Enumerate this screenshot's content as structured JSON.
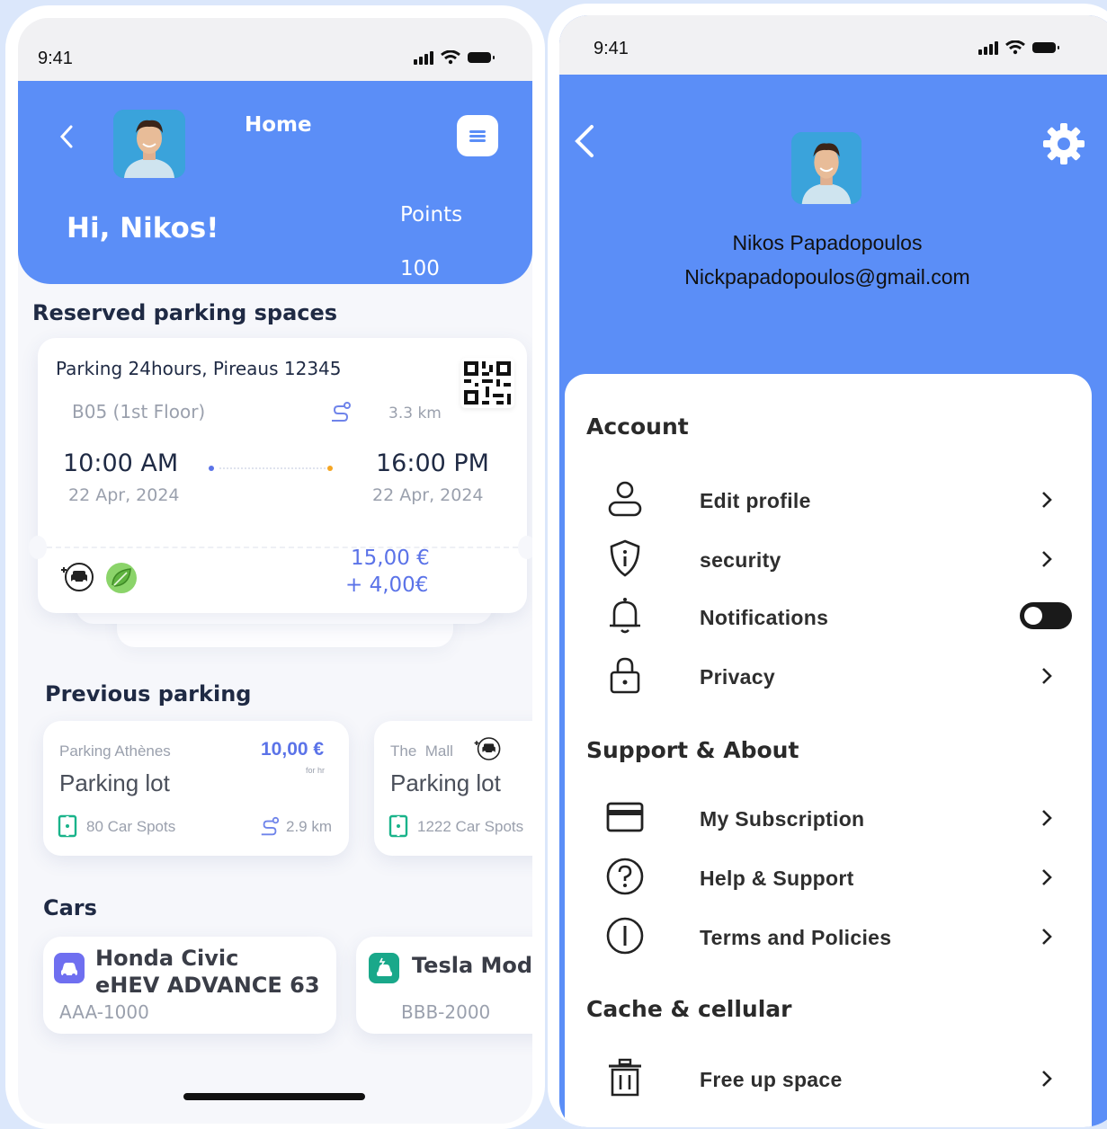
{
  "status": {
    "time": "9:41"
  },
  "home": {
    "title": "Home",
    "greeting": "Hi, Nikos!",
    "points_label": "Points",
    "points_value": "100",
    "reserved_title": "Reserved parking spaces",
    "reservation": {
      "location": "Parking 24hours, Pireaus 12345",
      "spot": "B05 (1st Floor)",
      "distance": "3.3 km",
      "start_time": "10:00 AM",
      "start_date": "22 Apr, 2024",
      "end_time": "16:00 PM",
      "end_date": "22 Apr, 2024",
      "price": "15,00 €",
      "extra": "+ 4,00€"
    },
    "previous_title": "Previous parking",
    "previous": [
      {
        "name": "Parking Athènes",
        "type": "Parking lot",
        "price": "10,00 €",
        "unit": "for hr",
        "spots": "80 Car Spots",
        "distance": "2.9 km"
      },
      {
        "name": "The  Mall",
        "type": "Parking lot",
        "spots": "1222 Car Spots"
      }
    ],
    "cars_title": "Cars",
    "cars": [
      {
        "model_line1": "Honda Civic",
        "model_line2": "eHEV ADVANCE 63",
        "plate": "AAA-1000"
      },
      {
        "model_line1": "Tesla Model",
        "plate": "BBB-2000"
      }
    ]
  },
  "profile": {
    "name": "Nikos Papadopoulos",
    "email": "Nickpapadopoulos@gmail.com",
    "account_title": "Account",
    "account_items": [
      {
        "label": "Edit profile"
      },
      {
        "label": "security"
      },
      {
        "label": "Notifications"
      },
      {
        "label": "Privacy"
      }
    ],
    "support_title": "Support & About",
    "support_items": [
      {
        "label": "My Subscription"
      },
      {
        "label": "Help & Support"
      },
      {
        "label": "Terms and Policies"
      }
    ],
    "cache_title": "Cache & cellular",
    "cache_items": [
      {
        "label": "Free up space"
      }
    ]
  },
  "colors": {
    "brand": "#5b8ef7",
    "price_blue": "#5b73e8",
    "start_dot": "#5b73e8",
    "end_dot": "#f5a623"
  }
}
